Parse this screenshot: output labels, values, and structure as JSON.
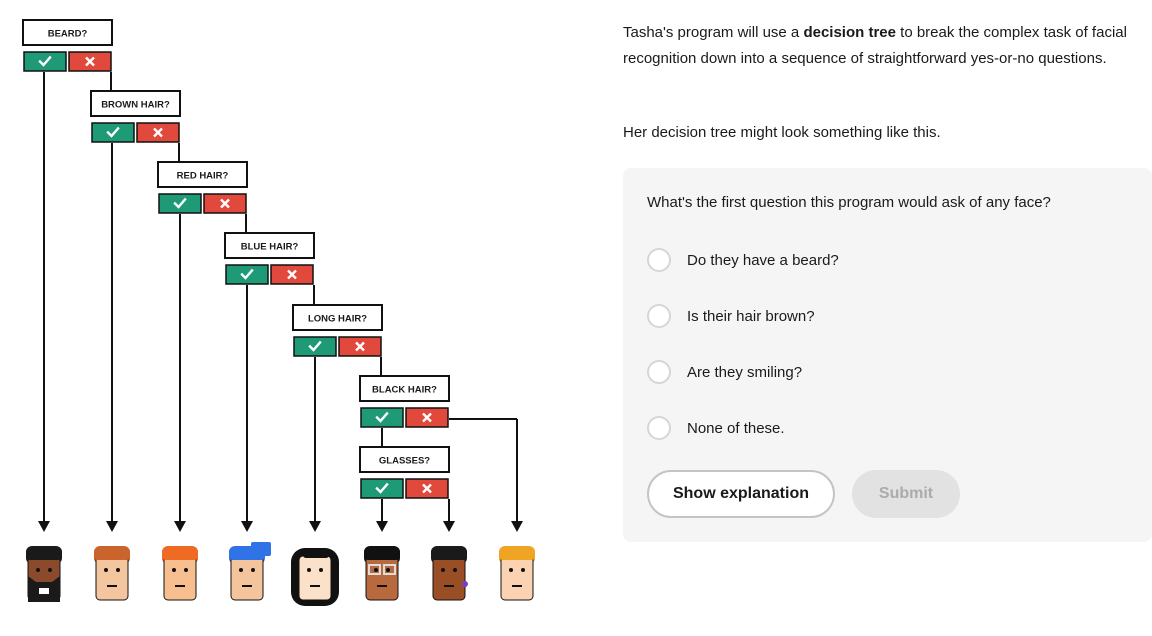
{
  "diagram": {
    "questions": [
      {
        "label": "BEARD?"
      },
      {
        "label": "BROWN HAIR?"
      },
      {
        "label": "RED HAIR?"
      },
      {
        "label": "BLUE HAIR?"
      },
      {
        "label": "LONG HAIR?"
      },
      {
        "label": "BLACK HAIR?"
      },
      {
        "label": "GLASSES?"
      }
    ],
    "yes_icon": "check-icon",
    "no_icon": "x-icon",
    "colors": {
      "yes": "#1f9a77",
      "no": "#e0493b",
      "line": "#111111"
    },
    "faces": [
      {
        "name": "bearded-face",
        "hair": "#1a1a1a",
        "skin": "#8b4a2b",
        "trait": "beard"
      },
      {
        "name": "brown-hair-face",
        "hair": "#c8642c",
        "skin": "#f4c6a0",
        "trait": "none"
      },
      {
        "name": "red-hair-face",
        "hair": "#ef6a22",
        "skin": "#f7bf8f",
        "trait": "none"
      },
      {
        "name": "blue-hair-face",
        "hair": "#2f73e6",
        "skin": "#f4c49c",
        "trait": "none"
      },
      {
        "name": "long-black-hair-face",
        "hair": "#111111",
        "skin": "#fbe1c9",
        "trait": "long"
      },
      {
        "name": "glasses-face",
        "hair": "#111111",
        "skin": "#b8693e",
        "trait": "glasses"
      },
      {
        "name": "dark-hair-face",
        "hair": "#1a1a1a",
        "skin": "#9a4e25",
        "trait": "earring"
      },
      {
        "name": "blonde-hair-face",
        "hair": "#f0a423",
        "skin": "#fbd2b2",
        "trait": "none"
      }
    ]
  },
  "intro": {
    "text_before": "Tasha's program will use a ",
    "bold": "decision tree",
    "text_after": " to break the complex task of facial recognition down into a sequence of straightforward yes-or-no questions.",
    "paragraph2": "Her decision tree might look something like this."
  },
  "quiz": {
    "question": "What's the first question this program would ask of any face?",
    "options": [
      {
        "label": "Do they have a beard?"
      },
      {
        "label": "Is their hair brown?"
      },
      {
        "label": "Are they smiling?"
      },
      {
        "label": "None of these."
      }
    ],
    "show_explanation_label": "Show explanation",
    "submit_label": "Submit"
  }
}
